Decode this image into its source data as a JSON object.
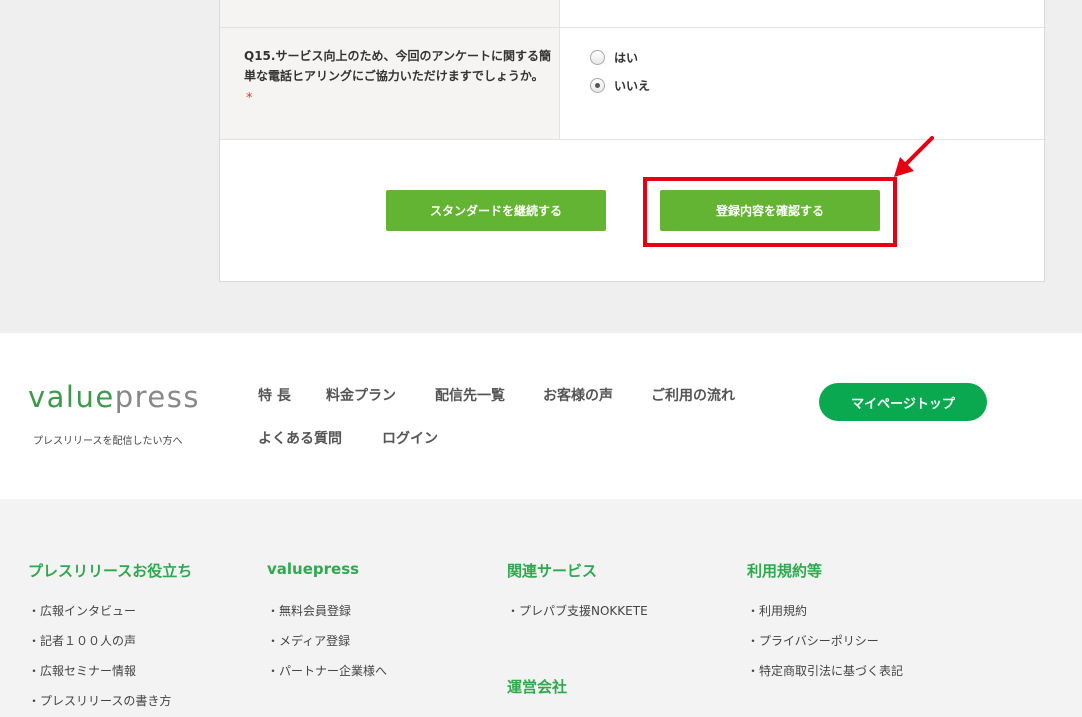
{
  "form": {
    "question": "Q15.サービス向上のため、今回のアンケートに関する簡単な電話ヒアリングにご協力いただけますでしょうか。",
    "required_mark": "*",
    "options": [
      {
        "label": "はい",
        "checked": false
      },
      {
        "label": "いいえ",
        "checked": true
      }
    ],
    "btn_standard": "スタンダードを継続する",
    "btn_confirm": "登録内容を確認する",
    "highlight_color": "#e60012"
  },
  "footer_nav": {
    "logo_part1": "value",
    "logo_part2": "press",
    "logo_sub": "プレスリリースを配信したい方へ",
    "items": [
      "特 長",
      "料金プラン",
      "配信先一覧",
      "お客様の声",
      "ご利用の流れ",
      "よくある質問",
      "ログイン"
    ],
    "mypage": "マイページトップ"
  },
  "footer_links": {
    "col1": {
      "title": "プレスリリースお役立ち",
      "links": [
        "・広報インタビュー",
        "・記者１００人の声",
        "・広報セミナー情報",
        "・プレスリリースの書き方"
      ]
    },
    "col2": {
      "title": "valuepress",
      "links": [
        "・無料会員登録",
        "・メディア登録",
        "・パートナー企業様へ"
      ]
    },
    "col3": {
      "title": "関連サービス",
      "links": [
        "・プレパブ支援NOKKETE"
      ],
      "title2": "運営会社"
    },
    "col4": {
      "title": "利用規約等",
      "links": [
        "・利用規約",
        "・プライバシーポリシー",
        "・特定商取引法に基づく表記"
      ]
    }
  }
}
